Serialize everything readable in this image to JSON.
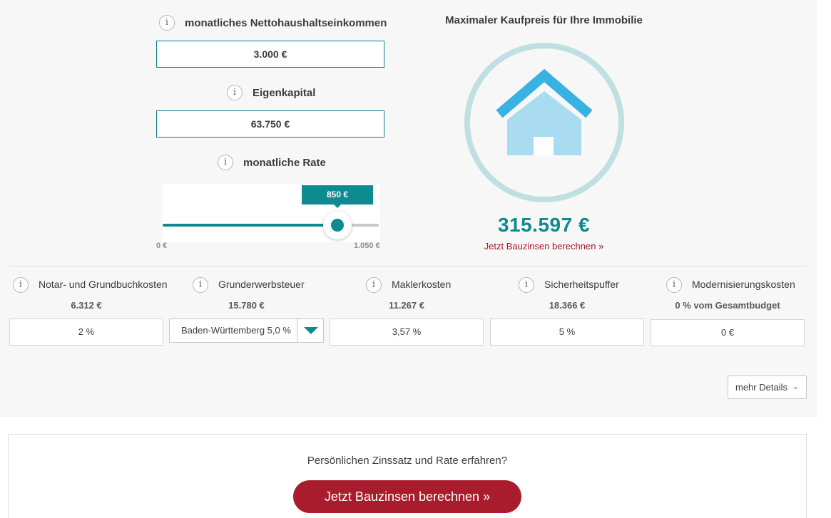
{
  "inputs": {
    "income": {
      "label": "monatliches Nettohaushaltseinkommen",
      "value": "3.000 €"
    },
    "equity": {
      "label": "Eigenkapital",
      "value": "63.750 €"
    },
    "rate": {
      "label": "monatliche Rate",
      "value_label": "850 €",
      "min_label": "0 €",
      "max_label": "1.050 €",
      "value": 850,
      "min": 0,
      "max": 1050
    }
  },
  "result": {
    "title": "Maximaler Kaufpreis für Ihre Immobilie",
    "amount": "315.597 €",
    "link_label": "Jetzt Bauzinsen berechnen »",
    "icon": "house-icon",
    "colors": {
      "ring": "#bfdfe2",
      "roof": "#38b2e3",
      "house": "#a9dcf1"
    }
  },
  "costs": [
    {
      "label": "Notar- und Grundbuchkosten",
      "amount": "6.312 €",
      "input": "2 %"
    },
    {
      "label": "Grunderwerbsteuer",
      "amount": "15.780 €",
      "input": "Baden-Württemberg 5,0 %"
    },
    {
      "label": "Maklerkosten",
      "amount": "11.267 €",
      "input": "3,57 %"
    },
    {
      "label": "Sicherheitspuffer",
      "amount": "18.366 €",
      "input": "5 %"
    },
    {
      "label": "Modernisierungskosten",
      "amount": "0 % vom Gesamtbudget",
      "input": "0 €"
    }
  ],
  "info_glyph": "i",
  "details_button": {
    "label": "mehr Details",
    "icon": "chevron-down-icon"
  },
  "cta": {
    "question": "Persönlichen Zinssatz und Rate erfahren?",
    "button_label": "Jetzt Bauzinsen berechnen »"
  },
  "colors": {
    "accent": "#0e8a91",
    "cta": "#a81c2d",
    "link": "#a11a2a"
  }
}
